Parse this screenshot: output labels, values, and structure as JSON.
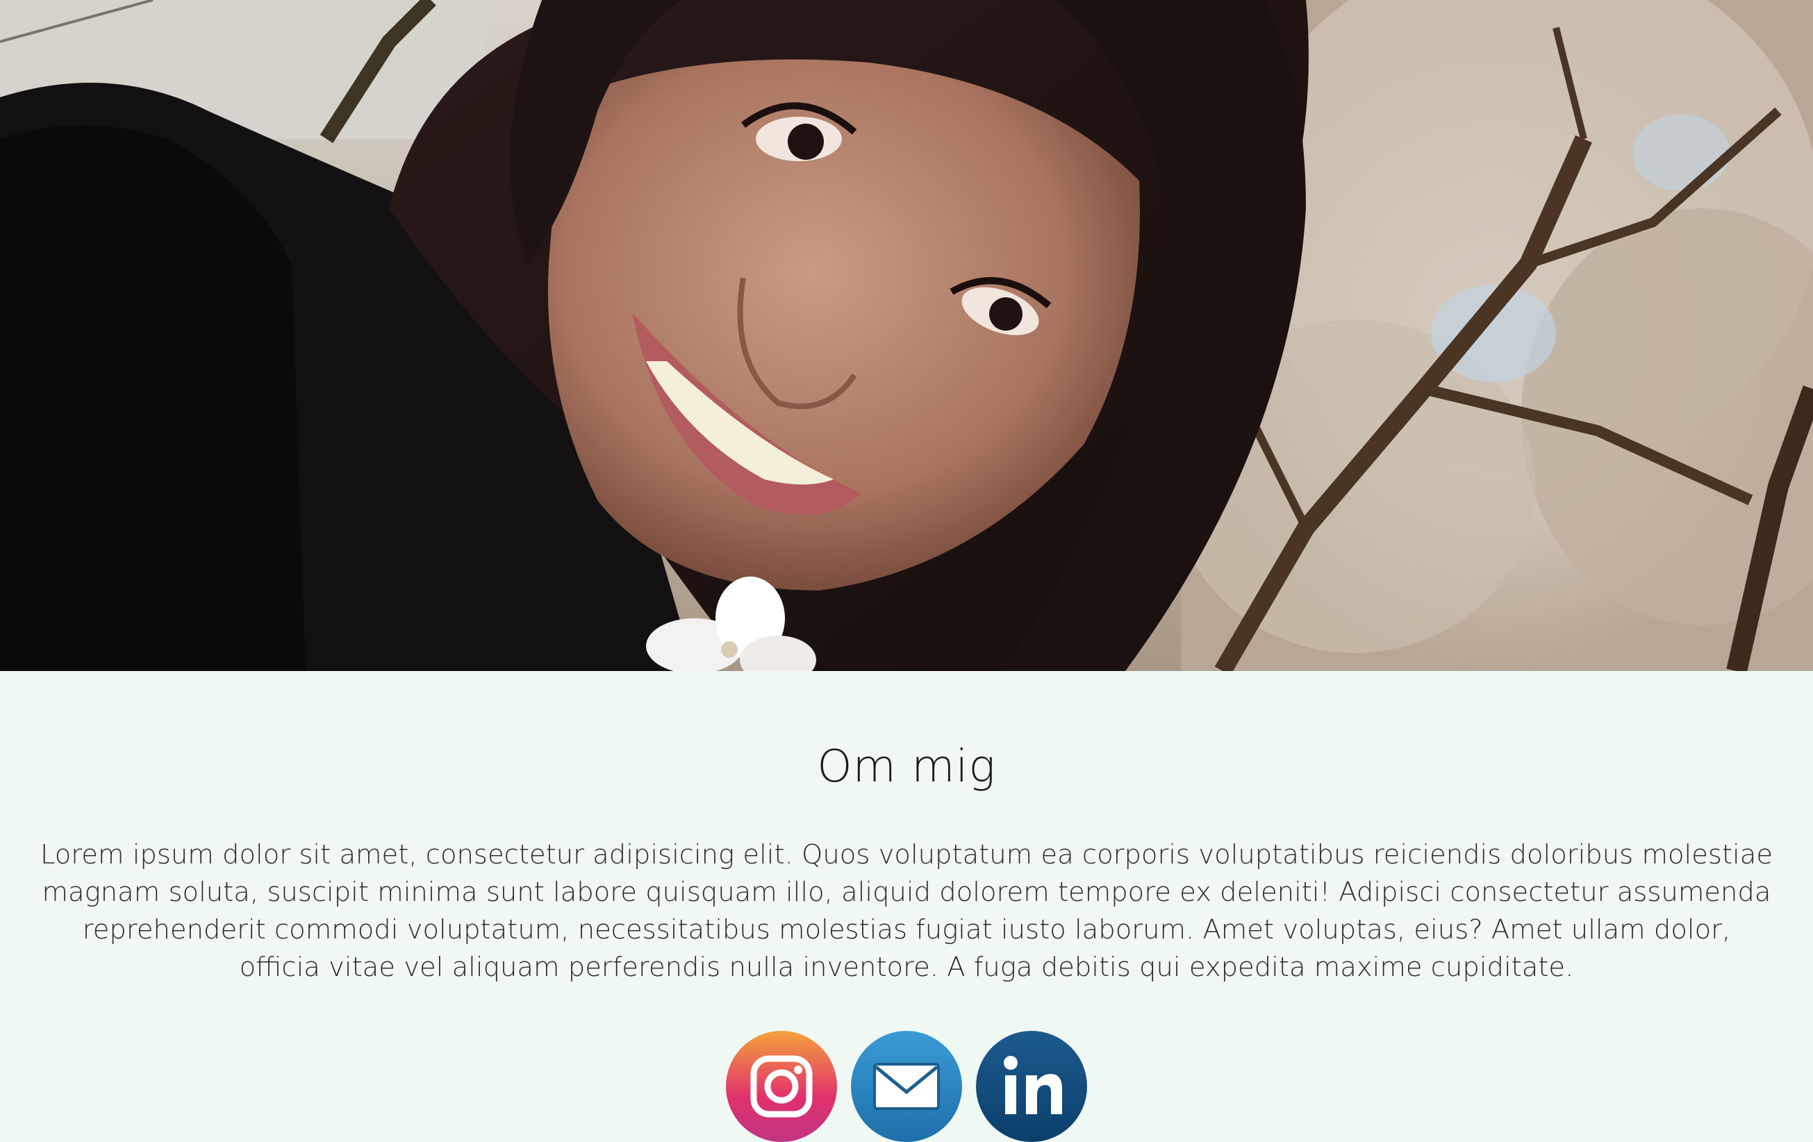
{
  "hero": {
    "image": "portrait-photo",
    "alt_subject": "smiling woman with cherry blossom"
  },
  "about": {
    "title": "Om mig",
    "body": "Lorem ipsum dolor sit amet, consectetur adipisicing elit. Quos voluptatum ea corporis voluptatibus reiciendis doloribus molestiae magnam soluta, suscipit minima sunt labore quisquam illo, aliquid dolorem tempore ex deleniti! Adipisci consectetur assumenda reprehenderit commodi voluptatum, necessitatibus molestias fugiat iusto laborum. Amet voluptas, eius? Amet ullam dolor, officia vitae vel aliquam perferendis nulla inventore. A fuga debitis qui expedita maxime cupiditate."
  },
  "social": [
    {
      "icon": "instagram-icon",
      "color": "#e1306c"
    },
    {
      "icon": "mail-icon",
      "color": "#2a86c3"
    },
    {
      "icon": "linkedin-icon",
      "color": "#0e4a7a"
    }
  ],
  "colors": {
    "background": "#f0f8f4",
    "text": "#1b1b1b"
  }
}
